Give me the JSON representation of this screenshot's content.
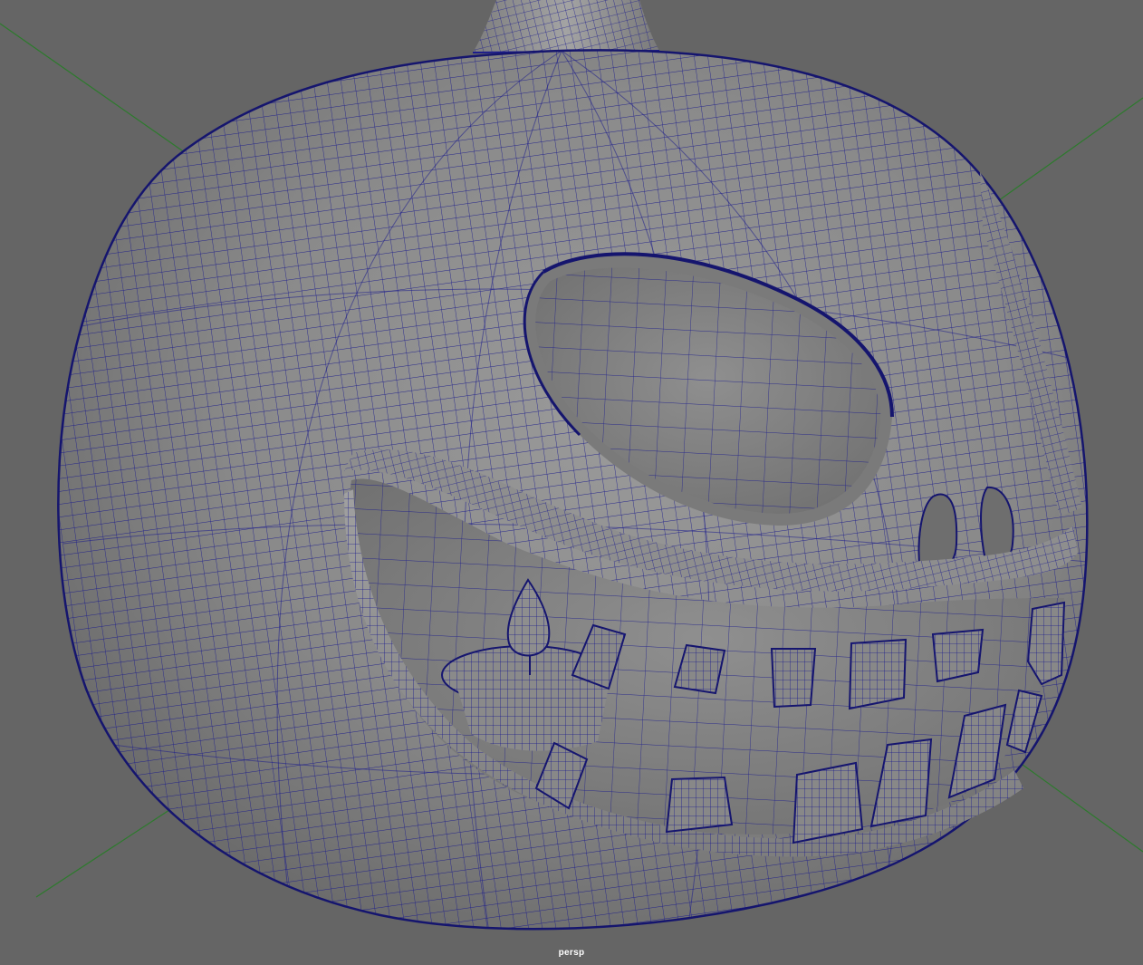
{
  "viewport": {
    "camera_label": "persp",
    "background_color": "#656565",
    "wireframe_color": "#1c1c8c",
    "grid_axis_color": "#2d7a2d",
    "shaded_surface_color": "#8c8c8c",
    "object": "carved-pumpkin-mesh"
  }
}
